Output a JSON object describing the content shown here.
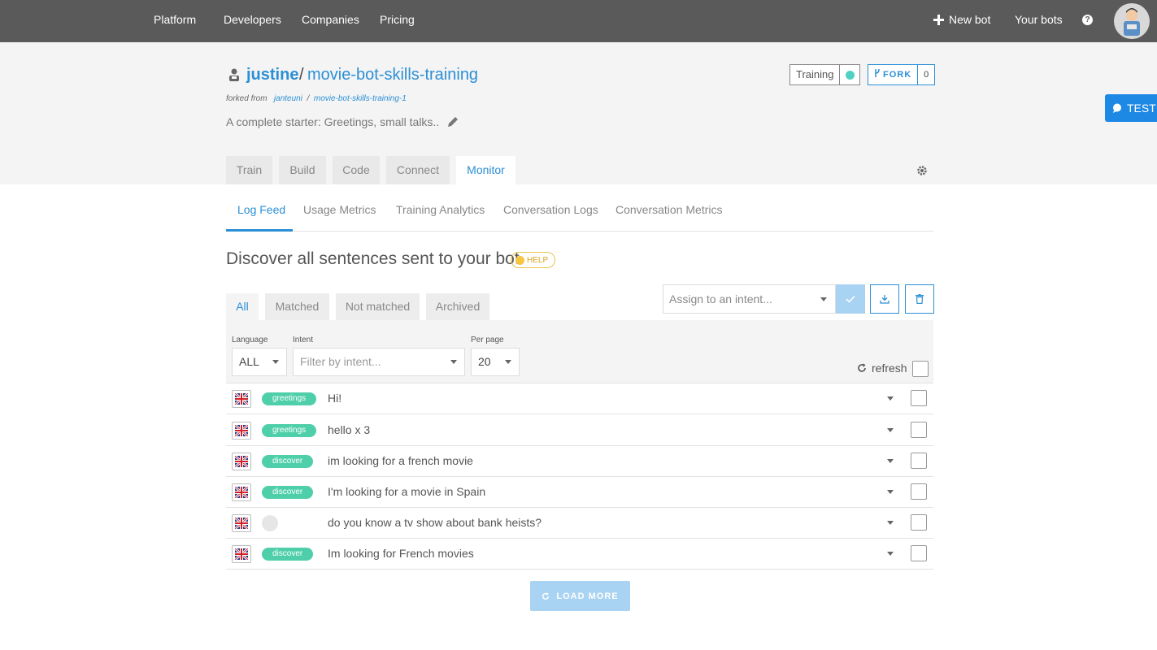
{
  "topnav": {
    "platform": "Platform",
    "developers": "Developers",
    "companies": "Companies",
    "pricing": "Pricing",
    "new_bot": "New bot",
    "your_bots": "Your bots"
  },
  "bot": {
    "user": "justine",
    "separator": "/",
    "name": "movie-bot-skills-training",
    "forked_from_label": "forked from",
    "fork_user": "janteuni",
    "fork_sep": "/",
    "fork_name": "movie-bot-skills-training-1",
    "description": "A complete starter: Greetings, small talks..",
    "status_label": "Training",
    "fork_label": "FORK",
    "fork_count": "0"
  },
  "test_label": "TEST",
  "tabs": [
    "Train",
    "Build",
    "Code",
    "Connect",
    "Monitor"
  ],
  "active_tab": "Monitor",
  "subtabs": [
    "Log Feed",
    "Usage Metrics",
    "Training Analytics",
    "Conversation Logs",
    "Conversation Metrics"
  ],
  "active_subtab": "Log Feed",
  "page_title": "Discover all sentences sent to your bot",
  "help_label": "HELP",
  "filter_tabs": [
    "All",
    "Matched",
    "Not matched",
    "Archived"
  ],
  "assign_placeholder": "Assign to an intent...",
  "filters": {
    "language_label": "Language",
    "language_value": "ALL",
    "intent_label": "Intent",
    "intent_placeholder": "Filter by intent...",
    "perpage_label": "Per page",
    "perpage_value": "20",
    "refresh_label": "refresh"
  },
  "logs": [
    {
      "intent": "greetings",
      "sentence": "Hi!"
    },
    {
      "intent": "greetings",
      "sentence": "hello  x 3"
    },
    {
      "intent": "discover",
      "sentence": "im looking for a french movie"
    },
    {
      "intent": "discover",
      "sentence": "I'm looking for a movie in Spain"
    },
    {
      "intent": "",
      "sentence": "do you know a tv show about bank heists?"
    },
    {
      "intent": "discover",
      "sentence": "Im looking for French movies"
    }
  ],
  "load_more": "LOAD MORE",
  "colors": {
    "accent": "#2b8fd6",
    "intent_pill": "#4fcfa9",
    "status_dot": "#4fd2c2",
    "topbar": "#5a5a5a"
  }
}
